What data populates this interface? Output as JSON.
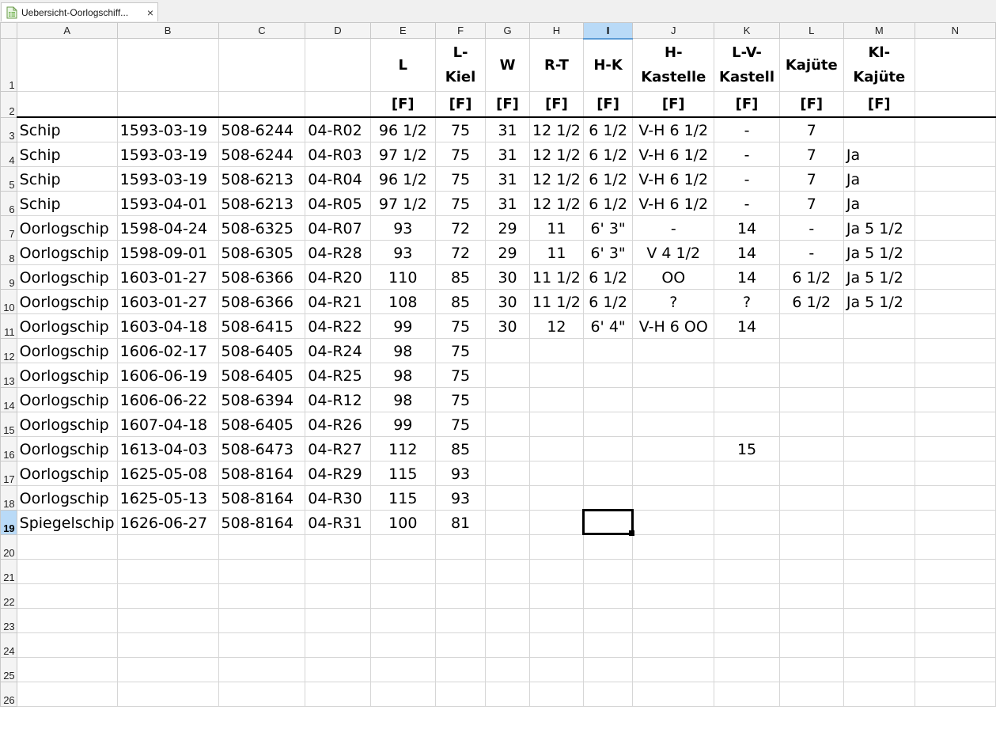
{
  "tab": {
    "title": "Uebersicht-Oorlogschiff...",
    "close": "×"
  },
  "columns": [
    "A",
    "B",
    "C",
    "D",
    "E",
    "F",
    "G",
    "H",
    "I",
    "J",
    "K",
    "L",
    "M",
    "N"
  ],
  "selected_column": "I",
  "selected_row": 19,
  "header_row1": [
    "",
    "",
    "",
    "",
    "L",
    "L-\nKiel",
    "W",
    "R-T",
    "H-K",
    "H-\nKastelle",
    "L-V-\nKastell",
    "Kajüte",
    "Kl-\nKajüte",
    ""
  ],
  "header_row2": [
    "",
    "",
    "",
    "",
    "[F]",
    "[F]",
    "[F]",
    "[F]",
    "[F]",
    "[F]",
    "[F]",
    "[F]",
    "[F]",
    ""
  ],
  "rows": [
    [
      "Schip",
      "1593-03-19",
      "508-6244",
      "04-R02",
      "96 1/2",
      "75",
      "31",
      "12 1/2",
      "6 1/2",
      "V-H 6 1/2",
      "-",
      "7",
      "",
      ""
    ],
    [
      "Schip",
      "1593-03-19",
      "508-6244",
      "04-R03",
      "97 1/2",
      "75",
      "31",
      "12 1/2",
      "6 1/2",
      "V-H 6 1/2",
      "-",
      "7",
      "Ja",
      ""
    ],
    [
      "Schip",
      "1593-03-19",
      "508-6213",
      "04-R04",
      "96 1/2",
      "75",
      "31",
      "12 1/2",
      "6 1/2",
      "V-H 6 1/2",
      "-",
      "7",
      "Ja",
      ""
    ],
    [
      "Schip",
      "1593-04-01",
      "508-6213",
      "04-R05",
      "97 1/2",
      "75",
      "31",
      "12 1/2",
      "6 1/2",
      "V-H 6 1/2",
      "-",
      "7",
      "Ja",
      ""
    ],
    [
      "Oorlogschip",
      "1598-04-24",
      "508-6325",
      "04-R07",
      "93",
      "72",
      "29",
      "11",
      "6' 3\"",
      "-",
      "14",
      "-",
      "Ja 5 1/2",
      ""
    ],
    [
      "Oorlogschip",
      "1598-09-01",
      "508-6305",
      "04-R28",
      "93",
      "72",
      "29",
      "11",
      "6' 3\"",
      "V 4 1/2",
      "14",
      "-",
      "Ja 5 1/2",
      ""
    ],
    [
      "Oorlogschip",
      "1603-01-27",
      "508-6366",
      "04-R20",
      "110",
      "85",
      "30",
      "11 1/2",
      "6 1/2",
      "OO",
      "14",
      "6 1/2",
      "Ja 5 1/2",
      ""
    ],
    [
      "Oorlogschip",
      "1603-01-27",
      "508-6366",
      "04-R21",
      "108",
      "85",
      "30",
      "11 1/2",
      "6 1/2",
      "?",
      "?",
      "6 1/2",
      "Ja 5 1/2",
      ""
    ],
    [
      "Oorlogschip",
      "1603-04-18",
      "508-6415",
      "04-R22",
      "99",
      "75",
      "30",
      "12",
      "6' 4\"",
      "V-H 6 OO",
      "14",
      "",
      "",
      ""
    ],
    [
      "Oorlogschip",
      "1606-02-17",
      "508-6405",
      "04-R24",
      "98",
      "75",
      "",
      "",
      "",
      "",
      "",
      "",
      "",
      ""
    ],
    [
      "Oorlogschip",
      "1606-06-19",
      "508-6405",
      "04-R25",
      "98",
      "75",
      "",
      "",
      "",
      "",
      "",
      "",
      "",
      ""
    ],
    [
      "Oorlogschip",
      "1606-06-22",
      "508-6394",
      "04-R12",
      "98",
      "75",
      "",
      "",
      "",
      "",
      "",
      "",
      "",
      ""
    ],
    [
      "Oorlogschip",
      "1607-04-18",
      "508-6405",
      "04-R26",
      "99",
      "75",
      "",
      "",
      "",
      "",
      "",
      "",
      "",
      ""
    ],
    [
      "Oorlogschip",
      "1613-04-03",
      "508-6473",
      "04-R27",
      "112",
      "85",
      "",
      "",
      "",
      "",
      "15",
      "",
      "",
      ""
    ],
    [
      "Oorlogschip",
      "1625-05-08",
      "508-8164",
      "04-R29",
      "115",
      "93",
      "",
      "",
      "",
      "",
      "",
      "",
      "",
      ""
    ],
    [
      "Oorlogschip",
      "1625-05-13",
      "508-8164",
      "04-R30",
      "115",
      "93",
      "",
      "",
      "",
      "",
      "",
      "",
      "",
      ""
    ],
    [
      "Spiegelschip",
      "1626-06-27",
      "508-8164",
      "04-R31",
      "100",
      "81",
      "",
      "",
      "",
      "",
      "",
      "",
      "",
      ""
    ]
  ],
  "empty_rows": [
    20,
    21,
    22,
    23,
    24,
    25,
    26
  ]
}
